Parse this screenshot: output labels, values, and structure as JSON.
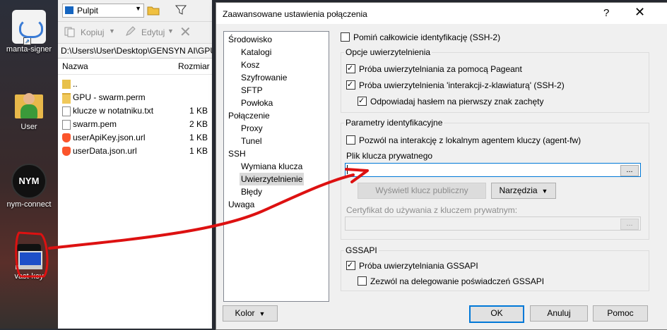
{
  "desktop": {
    "icons": [
      {
        "label": "manta-signer"
      },
      {
        "label": "User"
      },
      {
        "label": "nym-connect",
        "badge": "NYM"
      },
      {
        "label": "vast-key"
      }
    ]
  },
  "explorer": {
    "location": "Pulpit",
    "copy_label": "Kopiuj",
    "edit_label": "Edytuj",
    "path": "D:\\Users\\User\\Desktop\\GENSYN AI\\GPU",
    "col_name": "Nazwa",
    "col_size": "Rozmiar",
    "files": [
      {
        "name": "..",
        "size": ""
      },
      {
        "name": "GPU - swarm.perm",
        "size": ""
      },
      {
        "name": "klucze w notatniku.txt",
        "size": "1 KB"
      },
      {
        "name": "swarm.pem",
        "size": "2 KB"
      },
      {
        "name": "userApiKey.json.url",
        "size": "1 KB"
      },
      {
        "name": "userData.json.url",
        "size": "1 KB"
      }
    ]
  },
  "dialog": {
    "title": "Zaawansowane ustawienia połączenia",
    "help": "?",
    "close": "✕",
    "tree": [
      "Środowisko",
      "Katalogi",
      "Kosz",
      "Szyfrowanie",
      "SFTP",
      "Powłoka",
      "Połączenie",
      "Proxy",
      "Tunel",
      "SSH",
      "Wymiana klucza",
      "Uwierzytelnienie",
      "Błędy",
      "Uwaga"
    ],
    "skip_auth": "Pomiń całkowicie identyfikację (SSH-2)",
    "auth_group": "Opcje uwierzytelnienia",
    "pageant": "Próba uwierzytelniania za pomocą Pageant",
    "kbd_interactive": "Próba uwierzytelnienia 'interakcji-z-klawiaturą' (SSH-2)",
    "respond_password": "Odpowiadaj hasłem na pierwszy znak zachęty",
    "ident_group": "Parametry identyfikacyjne",
    "agent_fw": "Pozwól na interakcję z lokalnym agentem kluczy (agent-fw)",
    "private_key_label": "Plik klucza prywatnego",
    "private_key_value": "",
    "browse": "...",
    "show_public_key": "Wyświetl klucz publiczny",
    "tools": "Narzędzia",
    "cert_label": "Certyfikat do używania z kluczem prywatnym:",
    "gssapi_group": "GSSAPI",
    "gssapi_try": "Próba uwierzytelniania GSSAPI",
    "gssapi_delegate": "Zezwól na delegowanie poświadczeń GSSAPI",
    "color_button": "Kolor",
    "ok": "OK",
    "cancel": "Anuluj",
    "help_button": "Pomoc"
  }
}
